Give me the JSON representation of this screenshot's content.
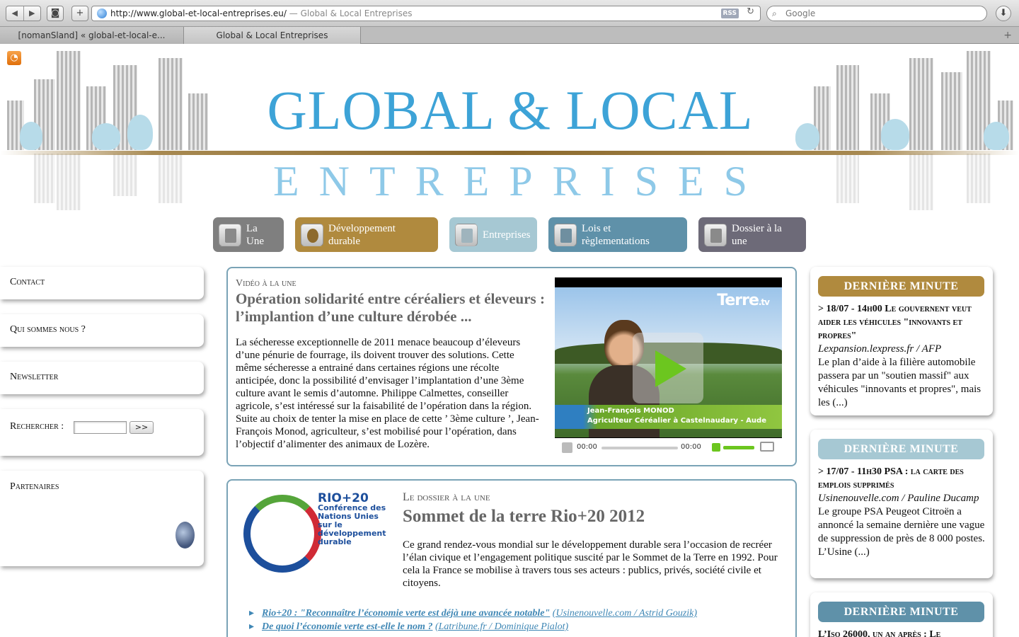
{
  "browser": {
    "url": "http://www.global-et-local-entreprises.eu/",
    "page_title": "— Global & Local Entreprises",
    "rss_badge": "RSS",
    "search_placeholder": "Google",
    "tabs": [
      {
        "label": "[nomanSland] « global-et-local-e..."
      },
      {
        "label": "Global & Local Entreprises"
      }
    ]
  },
  "banner": {
    "title": "GLOBAL & LOCAL",
    "subtitle": "ENTREPRISES",
    "rss_icon": "rss-icon"
  },
  "mainnav": {
    "items": [
      {
        "label": "La Une",
        "color": "#7f7f7f"
      },
      {
        "label": "Développement durable",
        "color": "#b08a3e"
      },
      {
        "label": "Entreprises",
        "color": "#a6c8d3"
      },
      {
        "label": "Lois et règlementations",
        "color": "#5f91a9"
      },
      {
        "label": "Dossier à la une",
        "color": "#6d6a78"
      }
    ]
  },
  "sidebar": {
    "contact": "Contact",
    "about": "Qui sommes nous ?",
    "newsletter": "Newsletter",
    "search_label": "Rechercher :",
    "search_value": "",
    "search_button": ">>",
    "partners": "Partenaires"
  },
  "video_card": {
    "kicker": "Vidéo à la une",
    "title": "Opération solidarité entre céréaliers et éleveurs : l’implantion d’une culture dérobée ...",
    "body": "La sécheresse exceptionnelle de 2011 menace beaucoup d’éleveurs d’une pénurie de fourrage, ils doivent trouver des solutions. Cette même sécheresse a entrainé dans certaines régions une récolte anticipée, donc la possibilité d’envisager l’implantation d’une 3ème culture avant le semis d’automne. Philippe Calmettes, conseiller agricole, s’est intéressé sur la faisabilité de l’opération dans la région. Suite au choix de tenter la mise en place de cette ’ 3ème culture ’, Jean-François Monod, agriculteur, s’est mobilisé pour l’opération, dans l’objectif d’alimenter des animaux de Lozère.",
    "video": {
      "brand": "Terre",
      "brand_suffix": ".tv",
      "caption_name": "Jean-François MONOD",
      "caption_role": "Agriculteur Céréalier à Castelnaudary - Aude",
      "time_current": "00:00",
      "time_total": "00:00"
    }
  },
  "dossier_card": {
    "kicker": "Le dossier à la une",
    "title": "Sommet de la terre Rio+20 2012",
    "body": "Ce grand rendez-vous mondial sur le développement durable sera l’occasion de recréer l’élan civique et l’engagement politique suscité par le Sommet de la Terre en 1992. Pour cela la France se mobilise à travers tous ses acteurs : publics, privés, société civile et citoyens.",
    "logo": {
      "title": "RIO+20",
      "lines": [
        "Conférence des",
        "Nations Unies",
        "sur le",
        "développement",
        "durable"
      ]
    },
    "links": [
      {
        "title": "Rio+20 : \"Reconnaître l’économie verte est déjà une avancée notable\"",
        "source": "(Usinenouvelle.com / Astrid Gouzik)"
      },
      {
        "title": "De quoi l’économie verte est-elle le nom ?",
        "source": "(Latribune.fr / Dominique Pialot)"
      }
    ]
  },
  "news": [
    {
      "header": "DERNIÈRE MINUTE",
      "header_color": "#b08a3e",
      "headline": "> 18/07 - 14h00 Le gouvernent veut aider les véhicules \"innovants et propres\"",
      "source": "Lexpansion.lexpress.fr / AFP",
      "text": "Le plan d’aide à la filière automobile passera par un \"soutien massif\" aux véhicules \"innovants et propres\", mais les (...)"
    },
    {
      "header": "DERNIÈRE MINUTE",
      "header_color": "#a6c8d3",
      "headline": "> 17/07 - 11h30 PSA : la carte des emplois supprimés",
      "source": "Usinenouvelle.com / Pauline Ducamp",
      "text": "Le groupe PSA Peugeot Citroën a annoncé la semaine dernière une vague de suppression de près de 8 000 postes. L’Usine (...)"
    },
    {
      "header": "DERNIÈRE MINUTE",
      "header_color": "#5f91a9",
      "headline": "L’Iso 26000, un an après : Le",
      "source": "",
      "text": ""
    }
  ]
}
